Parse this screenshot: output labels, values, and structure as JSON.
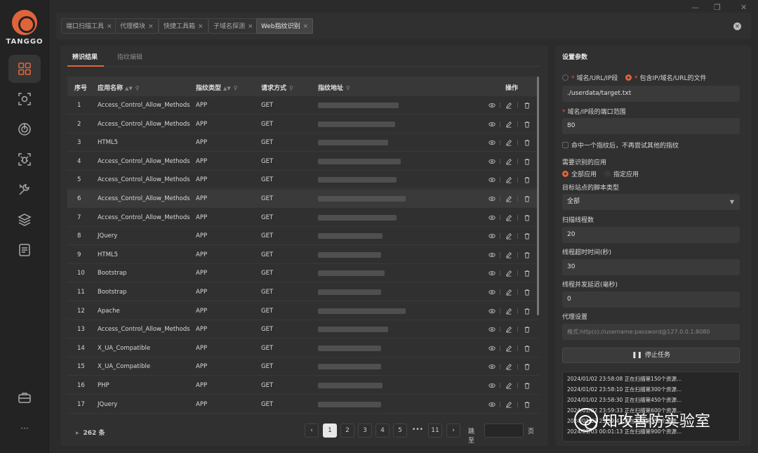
{
  "brand": {
    "name": "TANGGO",
    "accent": "#e0643a"
  },
  "window_controls": [
    "—",
    "❐",
    "✕"
  ],
  "sidebar": {
    "items": [
      {
        "icon": "grid-icon"
      },
      {
        "icon": "scan-icon"
      },
      {
        "icon": "radar-icon"
      },
      {
        "icon": "bug-scan-icon"
      },
      {
        "icon": "tools-icon"
      },
      {
        "icon": "layers-icon"
      },
      {
        "icon": "document-icon"
      },
      {
        "icon": "briefcase-icon"
      },
      {
        "icon": "more-icon",
        "label": "···"
      }
    ]
  },
  "tabs": [
    {
      "label": "端口扫描工具",
      "close": "×"
    },
    {
      "label": "代理模块",
      "close": "×"
    },
    {
      "label": "快捷工具箱",
      "close": "×"
    },
    {
      "label": "子域名探测",
      "close": "×"
    },
    {
      "label": "Web指纹识别",
      "close": "×",
      "active": true
    }
  ],
  "close_all": "✕",
  "main": {
    "subtabs": [
      "辨识结果",
      "指纹编辑"
    ],
    "columns": {
      "index": "序号",
      "app": "应用名称",
      "type": "指纹类型",
      "method": "请求方式",
      "url": "指纹地址",
      "ops": "操作"
    },
    "rows": [
      {
        "no": "1",
        "app": "Access_Control_Allow_Methods",
        "type": "APP",
        "method": "GET",
        "url": ""
      },
      {
        "no": "2",
        "app": "Access_Control_Allow_Methods",
        "type": "APP",
        "method": "GET",
        "url": ""
      },
      {
        "no": "3",
        "app": "HTML5",
        "type": "APP",
        "method": "GET",
        "url": ""
      },
      {
        "no": "4",
        "app": "Access_Control_Allow_Methods",
        "type": "APP",
        "method": "GET",
        "url": ""
      },
      {
        "no": "5",
        "app": "Access_Control_Allow_Methods",
        "type": "APP",
        "method": "GET",
        "url": ""
      },
      {
        "no": "6",
        "app": "Access_Control_Allow_Methods",
        "type": "APP",
        "method": "GET",
        "url": ""
      },
      {
        "no": "7",
        "app": "Access_Control_Allow_Methods",
        "type": "APP",
        "method": "GET",
        "url": ""
      },
      {
        "no": "8",
        "app": "JQuery",
        "type": "APP",
        "method": "GET",
        "url": ""
      },
      {
        "no": "9",
        "app": "HTML5",
        "type": "APP",
        "method": "GET",
        "url": ""
      },
      {
        "no": "10",
        "app": "Bootstrap",
        "type": "APP",
        "method": "GET",
        "url": ""
      },
      {
        "no": "11",
        "app": "Bootstrap",
        "type": "APP",
        "method": "GET",
        "url": ""
      },
      {
        "no": "12",
        "app": "Apache",
        "type": "APP",
        "method": "GET",
        "url": ""
      },
      {
        "no": "13",
        "app": "Access_Control_Allow_Methods",
        "type": "APP",
        "method": "GET",
        "url": ""
      },
      {
        "no": "14",
        "app": "X_UA_Compatible",
        "type": "APP",
        "method": "GET",
        "url": ""
      },
      {
        "no": "15",
        "app": "X_UA_Compatible",
        "type": "APP",
        "method": "GET",
        "url": ""
      },
      {
        "no": "16",
        "app": "PHP",
        "type": "APP",
        "method": "GET",
        "url": ""
      },
      {
        "no": "17",
        "app": "JQuery",
        "type": "APP",
        "method": "GET",
        "url": ""
      }
    ],
    "total": "262 条",
    "pager": {
      "prev": "‹",
      "pages": [
        "1",
        "2",
        "3",
        "4",
        "5",
        "•••",
        "11"
      ],
      "current": "1",
      "next": "›",
      "jump_label": "跳至",
      "page_label": "页"
    }
  },
  "settings": {
    "title": "设置参数",
    "target_mode": {
      "option1": "域名/URL/IP段",
      "option2": "包含IP/域名/URL的文件",
      "selected": "option2"
    },
    "target_file": "./userdata/target.txt",
    "port_label": "域名/IP段的端口范围",
    "port_value": "80",
    "stop_on_first": "命中一个指纹后，不再尝试其他的指纹",
    "apps_label": "需要识别的应用",
    "apps_all": "全部应用",
    "apps_specific": "指定应用",
    "script_label": "目标站点的脚本类型",
    "script_value": "全部",
    "threads_label": "扫描线程数",
    "threads_value": "20",
    "timeout_label": "线程超时时间(秒)",
    "timeout_value": "30",
    "delay_label": "线程并发延迟(毫秒)",
    "delay_value": "0",
    "proxy_label": "代理设置",
    "proxy_placeholder": "格式:http(s)://username:password@127.0.0.1:8080",
    "stop_button": "停止任务",
    "logs": [
      "2024/01/02 23:58:08 正在扫描第150个资源...",
      "2024/01/02 23:58:10 正在扫描第300个资源...",
      "2024/01/02 23:58:30 正在扫描第450个资源...",
      "2024/01/02 23:59:33 正在扫描第600个资源...",
      "2024/01/02 23:59:43 正在扫描第750个资源...",
      "2024/01/03 00:01:13 正在扫描第900个资源..."
    ]
  },
  "watermark": "知攻善防实验室"
}
